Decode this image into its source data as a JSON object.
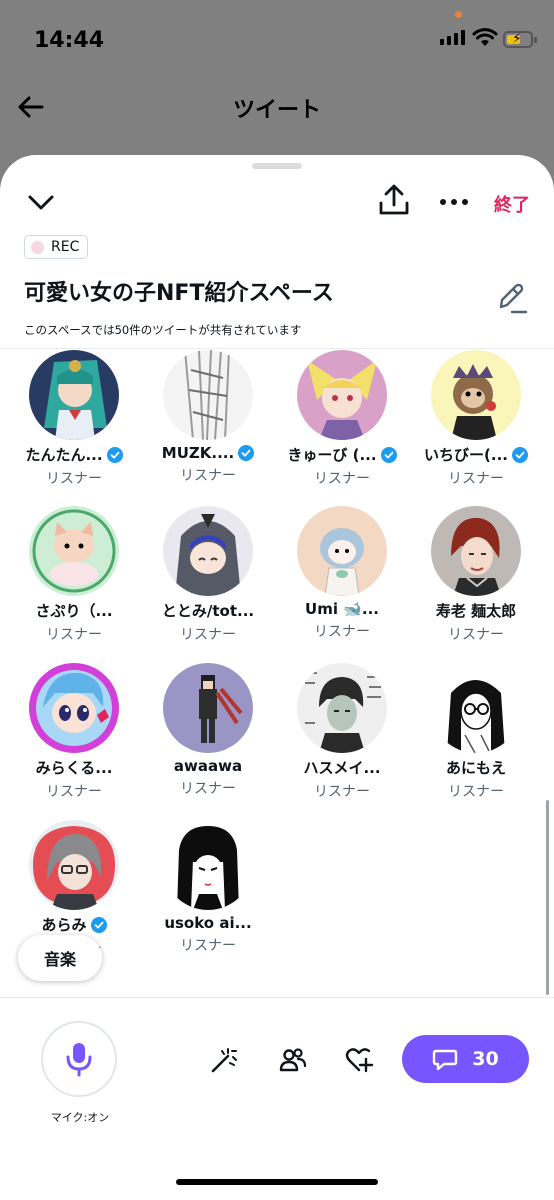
{
  "status_bar": {
    "time": "14:44"
  },
  "nav": {
    "title": "ツイート"
  },
  "sheet": {
    "end_label": "終了",
    "rec_label": "REC",
    "title": "可愛い女の子NFT紹介スペース",
    "subtitle": "このスペースでは50件のツイートが共有されています",
    "accent_color": "#7856ff",
    "end_color": "#e0245e"
  },
  "participants": [
    {
      "name": "たんたん...",
      "role": "リスナー",
      "verified": true
    },
    {
      "name": "MUZK....",
      "role": "リスナー",
      "verified": true
    },
    {
      "name": "きゅーび (...",
      "role": "リスナー",
      "verified": true
    },
    {
      "name": "いちびー(...",
      "role": "リスナー",
      "verified": true
    },
    {
      "name": "さぷり（...",
      "role": "リスナー",
      "verified": false
    },
    {
      "name": "ととみ/tot...",
      "role": "リスナー",
      "verified": false
    },
    {
      "name": "Umi 🐋...",
      "role": "リスナー",
      "verified": false
    },
    {
      "name": "寿老 麺太郎",
      "role": "リスナー",
      "verified": false
    },
    {
      "name": "みらくる...",
      "role": "リスナー",
      "verified": false
    },
    {
      "name": "awaawa",
      "role": "リスナー",
      "verified": false
    },
    {
      "name": "ハスメイ...",
      "role": "リスナー",
      "verified": false
    },
    {
      "name": "あにもえ",
      "role": "リスナー",
      "verified": false
    },
    {
      "name": "あらみ",
      "role": "リスナー",
      "verified": true
    },
    {
      "name": "usoko ai...",
      "role": "リスナー",
      "verified": false
    }
  ],
  "music_chip": "音楽",
  "bottom_bar": {
    "mic_label": "マイク:オン",
    "comment_count": "30"
  }
}
